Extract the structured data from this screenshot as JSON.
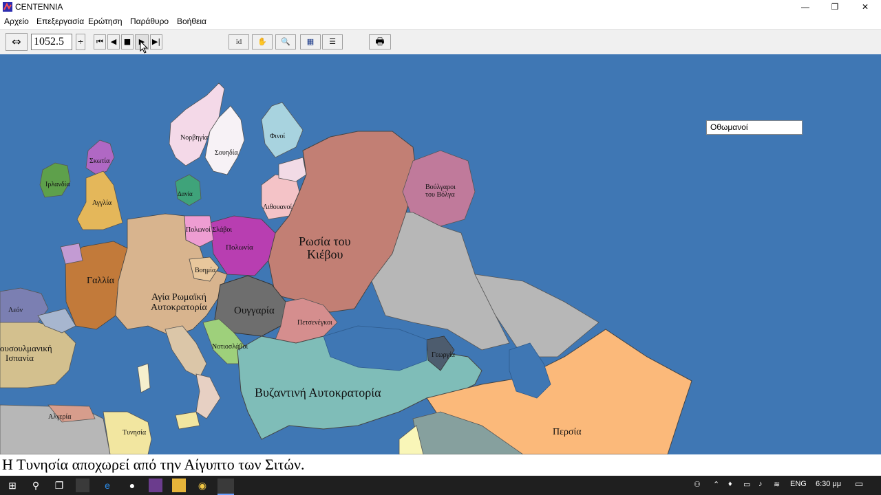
{
  "window": {
    "title": "CENTENNIA",
    "minimize": "—",
    "restore": "❐",
    "close": "✕"
  },
  "menu": [
    "Αρχείο",
    "Επεξεργασία",
    "Ερώτηση",
    "Παράθυρο",
    "Βοήθεια"
  ],
  "toolbar": {
    "year": "1052.5",
    "buttons": {
      "swap": "⇔",
      "spin": "÷",
      "first": "⏮",
      "prev": "◀",
      "stop": "■",
      "play": "▶",
      "next": "▶|",
      "identify": "id",
      "hand": "✋",
      "zoom": "🔍",
      "map": "▦",
      "list": "☰",
      "print": "🖶"
    }
  },
  "map": {
    "labels": [
      {
        "text": "Νορβηγία",
        "key": "norway"
      },
      {
        "text": "Σουηδία",
        "key": "sweden"
      },
      {
        "text": "Φινοί",
        "key": "finns"
      },
      {
        "text": "Σκωτία",
        "key": "scotland"
      },
      {
        "text": "Ιρλανδία",
        "key": "ireland"
      },
      {
        "text": "Αγγλία",
        "key": "england"
      },
      {
        "text": "Δανία",
        "key": "denmark"
      },
      {
        "text": "Λιθουανοί",
        "key": "lithuanians"
      },
      {
        "text": "Πολωνοί Σλάβοι",
        "key": "polish-slavs"
      },
      {
        "text": "Πολωνία",
        "key": "poland"
      },
      {
        "text": "Ρωσία του",
        "key": "kievan-1"
      },
      {
        "text": "Κιέβου",
        "key": "kievan-2"
      },
      {
        "text": "Βούλγαροι",
        "key": "volga-1"
      },
      {
        "text": "του Βόλγα",
        "key": "volga-2"
      },
      {
        "text": "Γαλλία",
        "key": "france"
      },
      {
        "text": "Βοημία",
        "key": "bohemia"
      },
      {
        "text": "Αγία Ρωμαϊκή",
        "key": "hre-1"
      },
      {
        "text": "Αυτοκρατορία",
        "key": "hre-2"
      },
      {
        "text": "Ουγγαρία",
        "key": "hungary"
      },
      {
        "text": "Πετσενέγκοι",
        "key": "pechenegs"
      },
      {
        "text": "Λεόν",
        "key": "leon"
      },
      {
        "text": "ουσουλμανική",
        "key": "muslim-1"
      },
      {
        "text": "Ισπανία",
        "key": "muslim-2"
      },
      {
        "text": "Νοτιοσλάβοι",
        "key": "south-slavs"
      },
      {
        "text": "Γεωργία",
        "key": "georgia"
      },
      {
        "text": "Βυζαντινή Αυτοκρατορία",
        "key": "byzantine"
      },
      {
        "text": "Αλγερία",
        "key": "algeria"
      },
      {
        "text": "Τυνησία",
        "key": "tunisia"
      },
      {
        "text": "Περσία",
        "key": "persia"
      }
    ],
    "popup": "Οθωμανοί"
  },
  "status": "Η Τυνησία αποχωρεί από την Αίγυπτο των Σιτών.",
  "taskbar": {
    "start": "⊞",
    "search": "⚲",
    "task_view": "❐",
    "lang": "ENG",
    "time": "6:30 μμ",
    "notify": "▭"
  },
  "colors": {
    "sea": "#3f77b4",
    "kievan_rus": "#c27f74",
    "poland": "#b83eb1",
    "hungary": "#6e6e6e",
    "byzantine": "#7fbdb8",
    "persia": "#fbb97a",
    "france": "#c27a3a",
    "hre": "#d8b48e"
  }
}
